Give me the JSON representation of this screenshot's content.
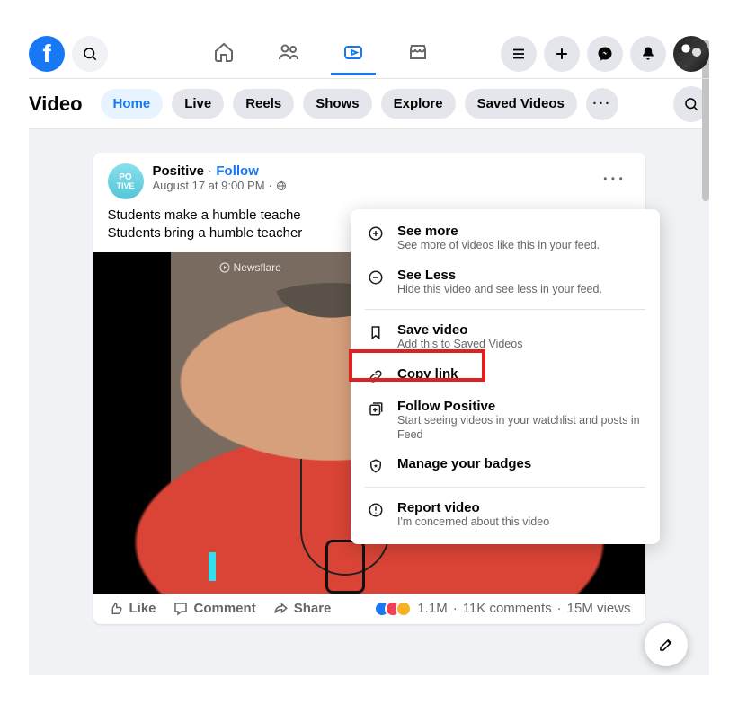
{
  "header": {
    "logo_letter": "f"
  },
  "video_tabs": {
    "title": "Video",
    "items": [
      "Home",
      "Live",
      "Reels",
      "Shows",
      "Explore",
      "Saved Videos"
    ]
  },
  "post": {
    "page_name": "Positive",
    "follow_label": "Follow",
    "timestamp": "August 17 at 9:00 PM",
    "body_line1": "Students make a humble teache",
    "body_line2": "Students bring a humble teacher",
    "watermark": "Newsflare"
  },
  "actions": {
    "like": "Like",
    "comment": "Comment",
    "share": "Share"
  },
  "stats": {
    "reactions": "1.1M",
    "comments": "11K comments",
    "views": "15M views"
  },
  "menu": {
    "see_more": {
      "title": "See more",
      "subtitle": "See more of videos like this in your feed."
    },
    "see_less": {
      "title": "See Less",
      "subtitle": "Hide this video and see less in your feed."
    },
    "save": {
      "title": "Save video",
      "subtitle": "Add this to Saved Videos"
    },
    "copy_link": {
      "title": "Copy link"
    },
    "follow_page": {
      "title": "Follow Positive",
      "subtitle": "Start seeing videos in your watchlist and posts in Feed"
    },
    "badges": {
      "title": "Manage your badges"
    },
    "report": {
      "title": "Report video",
      "subtitle": "I'm concerned about this video"
    }
  }
}
